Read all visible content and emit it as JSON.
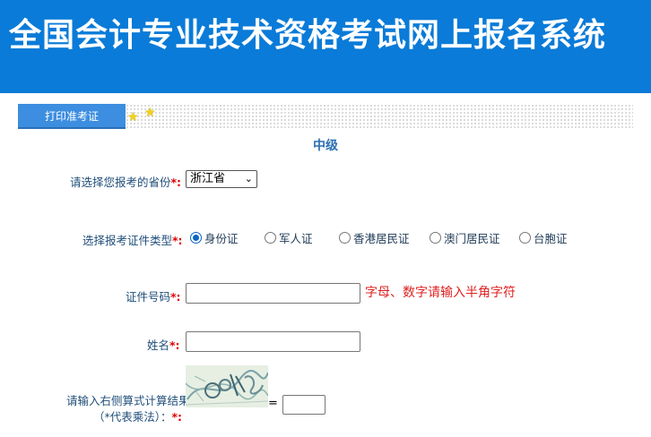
{
  "header": {
    "title": "全国会计专业技术资格考试网上报名系统"
  },
  "tabs": {
    "print_ticket": "打印准考证"
  },
  "section": {
    "title": "中级"
  },
  "form": {
    "province_label": "请选择您报考的省份",
    "province_value": "浙江省",
    "id_type_label": "选择报考证件类型",
    "id_types": [
      "身份证",
      "军人证",
      "香港居民证",
      "澳门居民证",
      "台胞证"
    ],
    "id_type_selected": "身份证",
    "id_number_label": "证件号码",
    "id_number_value": "",
    "id_number_hint": "字母、数字请输入半角字符",
    "name_label": "姓名",
    "name_value": "",
    "captcha_label_line1": "请输入右侧算式计算结果",
    "captcha_label_line2": "（*代表乘法）：",
    "captcha_equals": "=",
    "captcha_answer": "",
    "required_mark": "*:"
  },
  "colors": {
    "header_bg": "#0a7bd8",
    "tab_bg": "#3d8ee0",
    "required": "#e00000",
    "hint": "#e02020"
  },
  "icons": [
    "star-icon",
    "chevron-down-icon",
    "captcha-image"
  ]
}
